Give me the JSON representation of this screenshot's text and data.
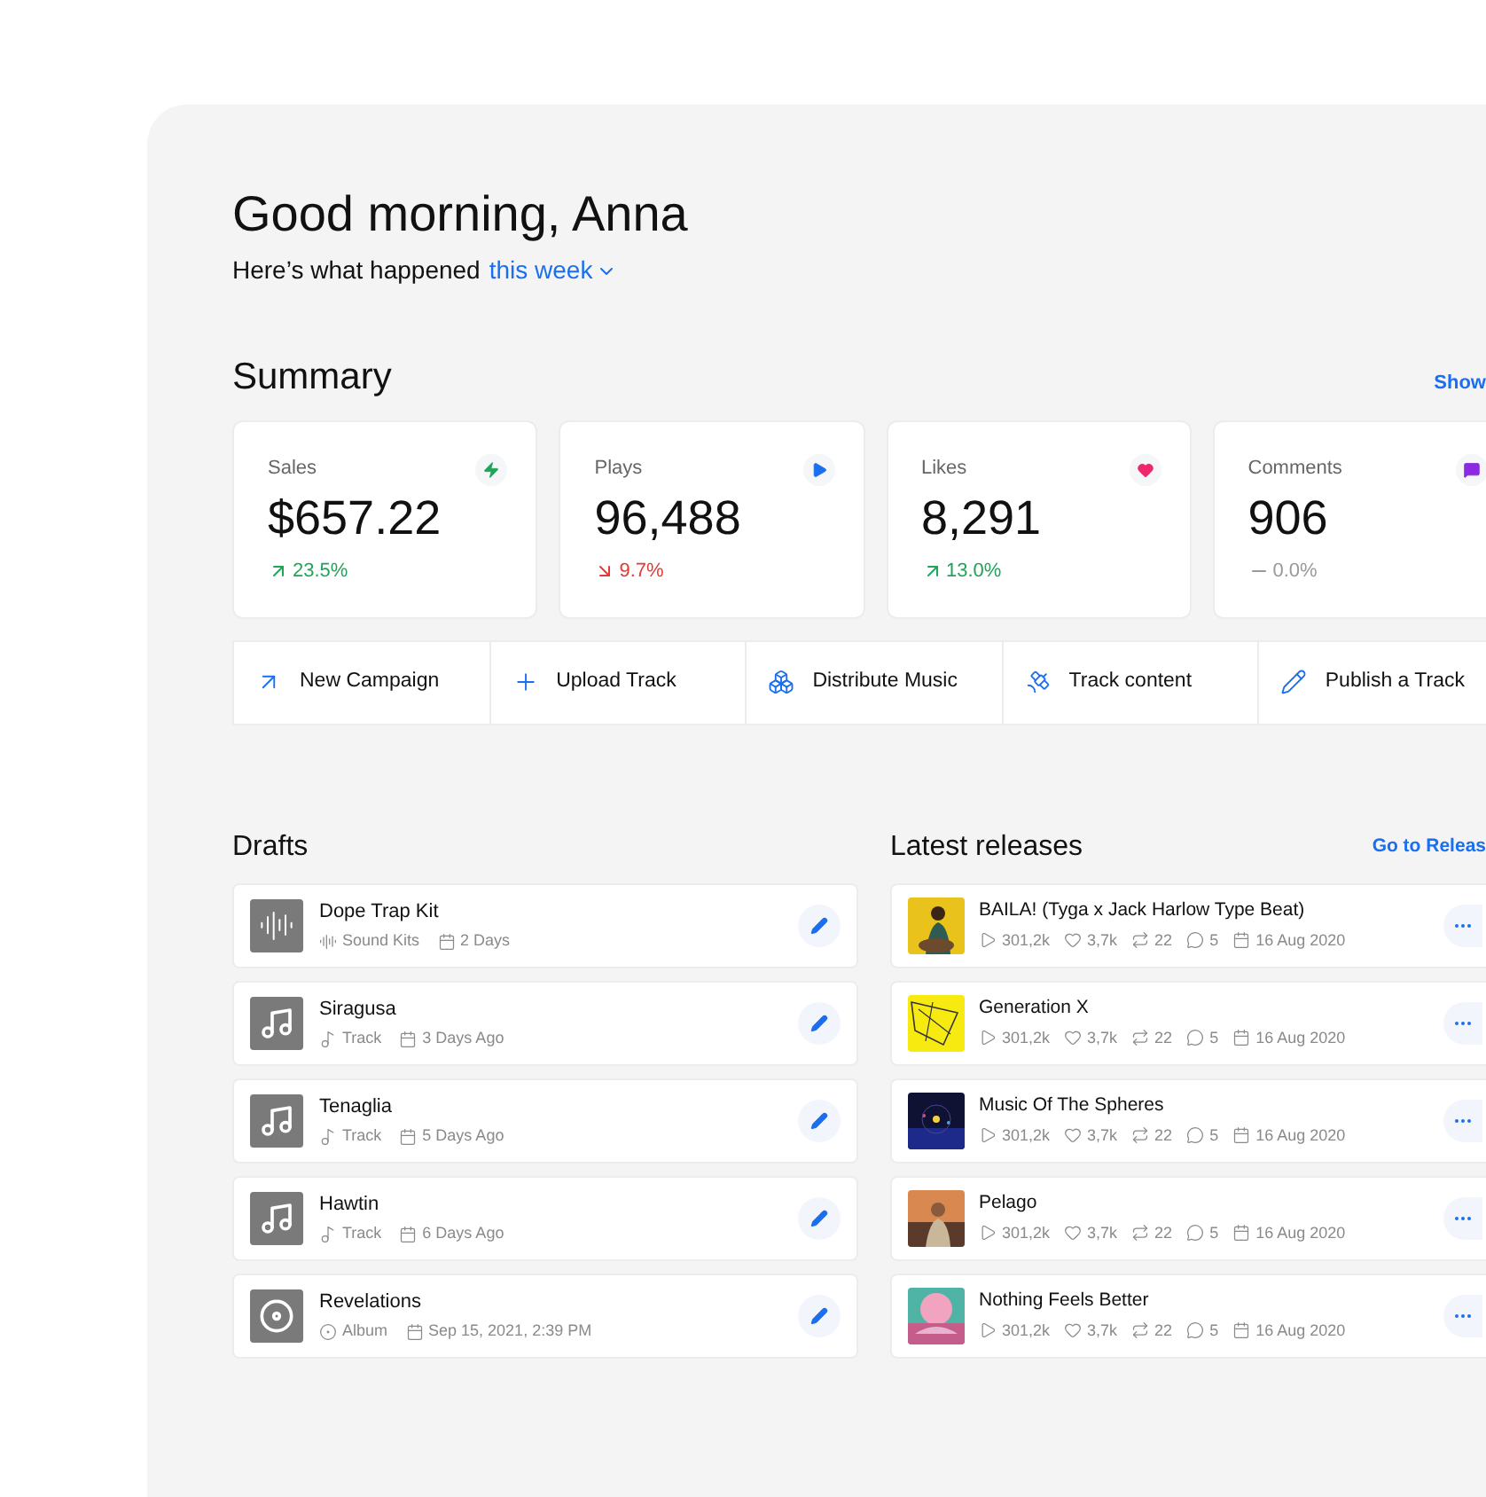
{
  "greeting": {
    "title": "Good morning, Anna",
    "subtitle": "Here’s what happened",
    "period": "this week"
  },
  "summary": {
    "title": "Summary",
    "link": "Show",
    "stats": [
      {
        "label": "Sales",
        "value": "$657.22",
        "change": "23.5%",
        "kind": "up"
      },
      {
        "label": "Plays",
        "value": "96,488",
        "change": "9.7%",
        "kind": "down"
      },
      {
        "label": "Likes",
        "value": "8,291",
        "change": "13.0%",
        "kind": "up"
      },
      {
        "label": "Comments",
        "value": "906",
        "change": "0.0%",
        "kind": "flat"
      }
    ]
  },
  "actions": [
    {
      "label": "New Campaign"
    },
    {
      "label": "Upload Track"
    },
    {
      "label": "Distribute Music"
    },
    {
      "label": "Track content"
    },
    {
      "label": "Publish a Track"
    }
  ],
  "drafts": {
    "title": "Drafts",
    "items": [
      {
        "kind": "kit",
        "name": "Dope Trap Kit",
        "type": "Sound Kits",
        "date": "2 Days"
      },
      {
        "kind": "track",
        "name": "Siragusa",
        "type": "Track",
        "date": "3 Days Ago"
      },
      {
        "kind": "track",
        "name": "Tenaglia",
        "type": "Track",
        "date": "5 Days Ago"
      },
      {
        "kind": "track",
        "name": "Hawtin",
        "type": "Track",
        "date": "6 Days Ago"
      },
      {
        "kind": "album",
        "name": "Revelations",
        "type": "Album",
        "date": "Sep 15, 2021, 2:39 PM"
      }
    ]
  },
  "releases": {
    "title": "Latest releases",
    "link": "Go to Releas",
    "items": [
      {
        "name": "BAILA! (Tyga x Jack Harlow Type Beat)",
        "plays": "301,2k",
        "likes": "3,7k",
        "reposts": "22",
        "comments": "5",
        "date": "16 Aug 2020"
      },
      {
        "name": "Generation X",
        "plays": "301,2k",
        "likes": "3,7k",
        "reposts": "22",
        "comments": "5",
        "date": "16 Aug 2020"
      },
      {
        "name": "Music Of The Spheres",
        "plays": "301,2k",
        "likes": "3,7k",
        "reposts": "22",
        "comments": "5",
        "date": "16 Aug 2020"
      },
      {
        "name": "Pelago",
        "plays": "301,2k",
        "likes": "3,7k",
        "reposts": "22",
        "comments": "5",
        "date": "16 Aug 2020"
      },
      {
        "name": "Nothing Feels Better",
        "plays": "301,2k",
        "likes": "3,7k",
        "reposts": "22",
        "comments": "5",
        "date": "16 Aug 2020"
      }
    ]
  }
}
